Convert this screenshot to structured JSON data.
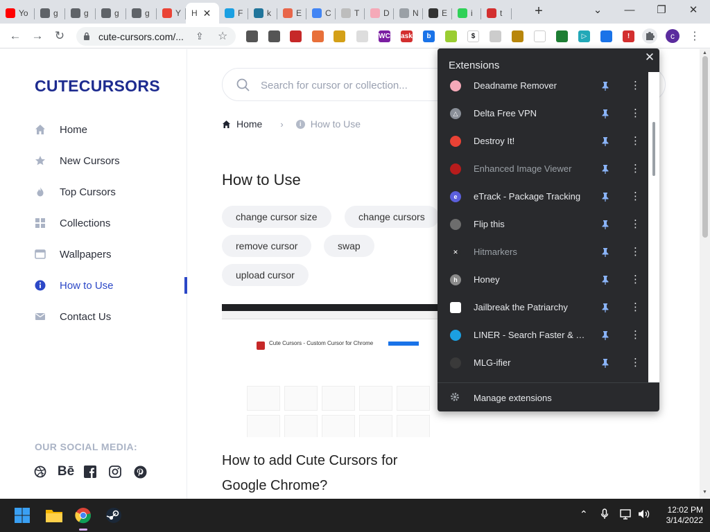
{
  "browser": {
    "tabs": [
      {
        "label": "Yo",
        "icon": "youtube-icon",
        "color": "#ff0000"
      },
      {
        "label": "g",
        "icon": "chrome-icon",
        "color": "#5f6368"
      },
      {
        "label": "g",
        "icon": "chrome-icon",
        "color": "#5f6368"
      },
      {
        "label": "g",
        "icon": "chrome-icon",
        "color": "#5f6368"
      },
      {
        "label": "g",
        "icon": "chrome-icon",
        "color": "#5f6368"
      },
      {
        "label": "Y",
        "icon": "gmail-icon",
        "color": "#ea4335"
      },
      {
        "label": "H",
        "icon": "",
        "color": "#ffffff",
        "active": true
      },
      {
        "label": "F",
        "icon": "liner-icon",
        "color": "#1ba0e2"
      },
      {
        "label": "k",
        "icon": "wordpress-icon",
        "color": "#21759b"
      },
      {
        "label": "E",
        "icon": "image-icon",
        "color": "#e8664a"
      },
      {
        "label": "C",
        "icon": "google-icon",
        "color": "#4285f4"
      },
      {
        "label": "T",
        "icon": "r-icon",
        "color": "#bdbdbd"
      },
      {
        "label": "D",
        "icon": "flag-icon",
        "color": "#f5a9b8"
      },
      {
        "label": "N",
        "icon": "doc-icon",
        "color": "#9aa0a6"
      },
      {
        "label": "E",
        "icon": "puzzle-icon",
        "color": "#333333"
      },
      {
        "label": "i",
        "icon": "messages-icon",
        "color": "#30d158"
      },
      {
        "label": "t",
        "icon": "ask-icon",
        "color": "#d32f2f"
      }
    ],
    "url": "cute-cursors.com/...",
    "profile_initial": "c",
    "toolbar_extensions": [
      {
        "name": "toolbar-ext-1",
        "color": "#555555",
        "glyph": ""
      },
      {
        "name": "toolbar-ext-2",
        "color": "#555555",
        "glyph": ""
      },
      {
        "name": "toolbar-ext-3",
        "color": "#c62828",
        "glyph": ""
      },
      {
        "name": "toolbar-ext-4",
        "color": "#e8703a",
        "glyph": ""
      },
      {
        "name": "toolbar-ext-5",
        "color": "#d4a017",
        "glyph": ""
      },
      {
        "name": "toolbar-ext-6",
        "color": "#dddddd",
        "glyph": ""
      },
      {
        "name": "toolbar-ext-7",
        "color": "#7b1fa2",
        "glyph": "WC"
      },
      {
        "name": "toolbar-ext-8",
        "color": "#d32f2f",
        "glyph": "ask"
      },
      {
        "name": "toolbar-ext-9",
        "color": "#1a73e8",
        "glyph": "b"
      },
      {
        "name": "toolbar-ext-10",
        "color": "#9acd32",
        "glyph": ""
      },
      {
        "name": "toolbar-ext-11",
        "color": "#ffffff",
        "glyph": "$"
      },
      {
        "name": "toolbar-ext-12",
        "color": "#cccccc",
        "glyph": ""
      },
      {
        "name": "toolbar-ext-13",
        "color": "#b8860b",
        "glyph": ""
      },
      {
        "name": "toolbar-ext-14",
        "color": "#ffffff",
        "glyph": ""
      },
      {
        "name": "toolbar-ext-15",
        "color": "#1e7e34",
        "glyph": ""
      },
      {
        "name": "toolbar-ext-16",
        "color": "#22a8b8",
        "glyph": "▷"
      },
      {
        "name": "toolbar-ext-17",
        "color": "#1a73e8",
        "glyph": ""
      },
      {
        "name": "toolbar-ext-18",
        "color": "#d32f2f",
        "glyph": "!"
      }
    ]
  },
  "site": {
    "logo": "CUTECURSORS",
    "nav": [
      {
        "label": "Home",
        "icon": "home-icon",
        "active": false
      },
      {
        "label": "New Cursors",
        "icon": "star-icon",
        "active": false
      },
      {
        "label": "Top Cursors",
        "icon": "flame-icon",
        "active": false
      },
      {
        "label": "Collections",
        "icon": "grid-icon",
        "active": false
      },
      {
        "label": "Wallpapers",
        "icon": "window-icon",
        "active": false
      },
      {
        "label": "How to Use",
        "icon": "info-icon",
        "active": true
      },
      {
        "label": "Contact Us",
        "icon": "mail-icon",
        "active": false
      }
    ],
    "social_title": "OUR SOCIAL MEDIA:",
    "social_icons": [
      "dribbble-icon",
      "behance-icon",
      "facebook-icon",
      "instagram-icon",
      "pinterest-icon"
    ],
    "behance_text": "Bē",
    "search_placeholder": "Search for cursor or collection...",
    "breadcrumb": {
      "home": "Home",
      "current": "How to Use"
    },
    "heading": "How to Use",
    "tags": [
      "change cursor size",
      "change cursors",
      "remove cursor",
      "swap",
      "upload cursor"
    ],
    "screenshot_title": "Cute Cursors - Custom Cursor for Chrome",
    "subheading": "How to add Cute Cursors for Google Chrome?",
    "accent_color": "#2c48c7",
    "logo_color": "#1d2b8f"
  },
  "extensions_popup": {
    "title": "Extensions",
    "items": [
      {
        "name": "Deadname Remover",
        "enabled": true,
        "color": "#f5a9b8",
        "glyph": ""
      },
      {
        "name": "Delta Free VPN",
        "enabled": true,
        "color": "#8a8f98",
        "glyph": "△"
      },
      {
        "name": "Destroy It!",
        "enabled": true,
        "color": "#e94235",
        "glyph": ""
      },
      {
        "name": "Enhanced Image Viewer",
        "enabled": false,
        "color": "#b71c1c",
        "glyph": ""
      },
      {
        "name": "eTrack - Package Tracking",
        "enabled": true,
        "color": "#5b5fdb",
        "glyph": "e"
      },
      {
        "name": "Flip this",
        "enabled": true,
        "color": "#6d6d6d",
        "glyph": ""
      },
      {
        "name": "Hitmarkers",
        "enabled": false,
        "color": "#292a2d",
        "glyph": "✕"
      },
      {
        "name": "Honey",
        "enabled": true,
        "color": "#8a8a8a",
        "glyph": "h"
      },
      {
        "name": "Jailbreak the Patriarchy",
        "enabled": true,
        "color": "#ffffff",
        "glyph": ""
      },
      {
        "name": "LINER - Search Faster & Hig...",
        "enabled": true,
        "color": "#1ba0e2",
        "glyph": ""
      },
      {
        "name": "MLG-ifier",
        "enabled": true,
        "color": "#3a3a3a",
        "glyph": ""
      }
    ],
    "manage_label": "Manage extensions"
  },
  "taskbar": {
    "apps": [
      "windows-start-icon",
      "file-explorer-icon",
      "chrome-icon",
      "steam-icon"
    ],
    "time": "12:02 PM",
    "date": "3/14/2022"
  }
}
